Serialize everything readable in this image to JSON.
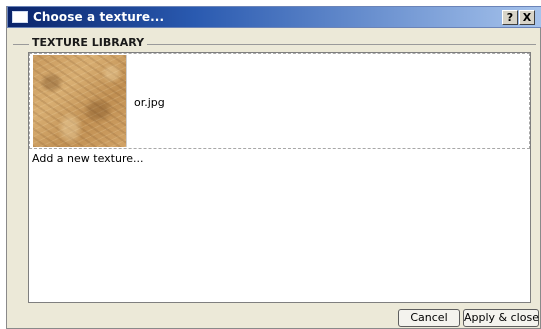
{
  "window": {
    "title": "Choose a texture...",
    "help_label": "?",
    "close_label": "X"
  },
  "group": {
    "label": "TEXTURE LIBRARY"
  },
  "textures": {
    "items": [
      {
        "name": "or.jpg",
        "thumbnail": "sand-leather-texture"
      }
    ],
    "add_label": "Add a new texture..."
  },
  "buttons": {
    "cancel_label": "Cancel",
    "apply_label": "Apply & close"
  },
  "colors": {
    "titlebar_start": "#0a246a",
    "titlebar_end": "#a6c3ec",
    "dialog_background": "#ece9d8",
    "texture_tone": "#c99a5e"
  }
}
